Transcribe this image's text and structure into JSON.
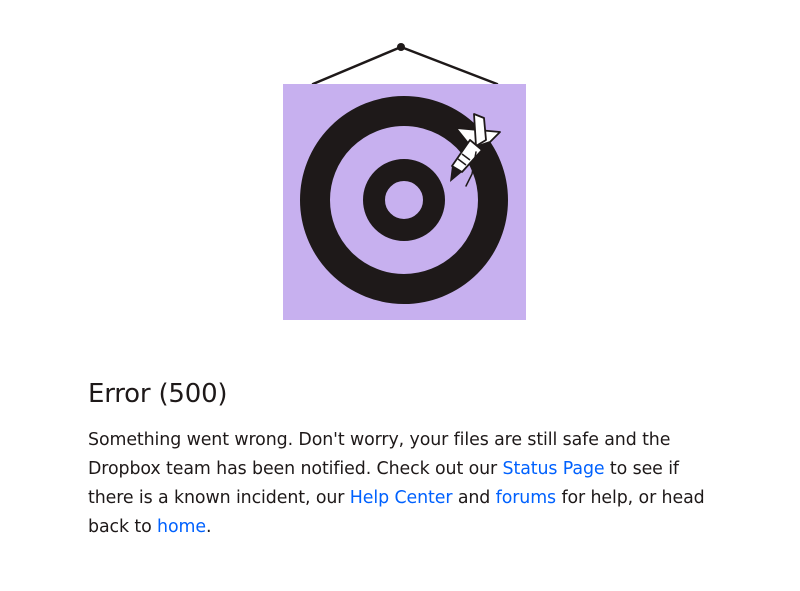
{
  "error": {
    "title": "Error (500)",
    "message": {
      "part1": "Something went wrong. Don't worry, your files are still safe and the Dropbox team has been notified. Check out our ",
      "status_link": "Status Page",
      "part2": " to see if there is a known incident, our ",
      "help_link": "Help Center",
      "part3": " and ",
      "forums_link": "forums",
      "part4": " for help, or head back to ",
      "home_link": "home",
      "part5": "."
    }
  },
  "illustration": {
    "name": "dartboard-illustration",
    "board_color": "#c7b0ef",
    "ring_color": "#1e1919"
  },
  "colors": {
    "link": "#0061fe",
    "text": "#1e1919"
  }
}
